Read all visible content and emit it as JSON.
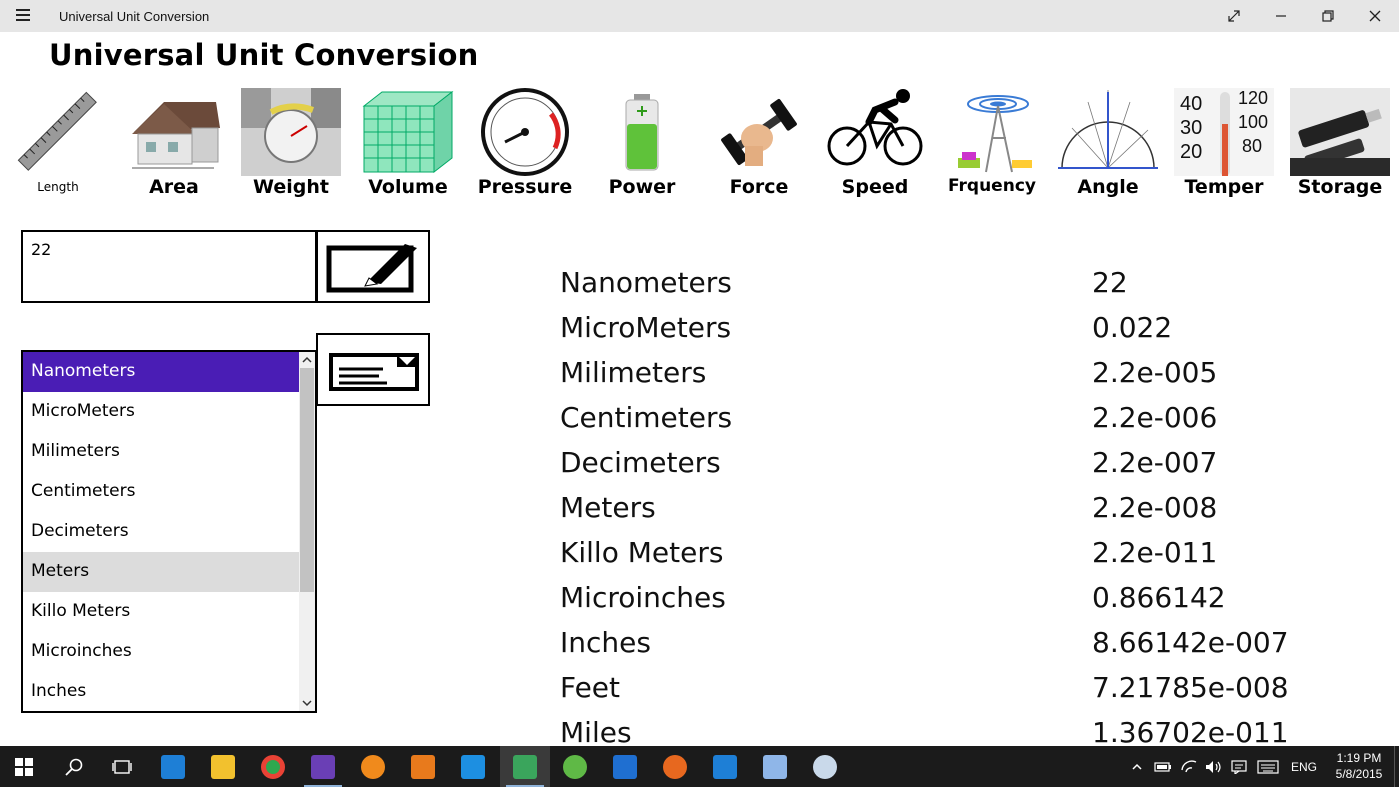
{
  "window": {
    "title": "Universal Unit Conversion"
  },
  "page": {
    "title": "Universal Unit Conversion"
  },
  "categories": [
    {
      "label": "Length",
      "icon": "ruler-icon"
    },
    {
      "label": "Area",
      "icon": "house-icon"
    },
    {
      "label": "Weight",
      "icon": "scale-icon"
    },
    {
      "label": "Volume",
      "icon": "cube-icon"
    },
    {
      "label": "Pressure",
      "icon": "gauge-icon"
    },
    {
      "label": "Power",
      "icon": "battery-icon"
    },
    {
      "label": "Force",
      "icon": "dumbbell-icon"
    },
    {
      "label": "Speed",
      "icon": "cyclist-icon"
    },
    {
      "label": "Frquency",
      "icon": "antenna-icon"
    },
    {
      "label": "Angle",
      "icon": "protractor-icon"
    },
    {
      "label": "Temper",
      "icon": "thermometer-icon"
    },
    {
      "label": "Storage",
      "icon": "usb-drive-icon"
    }
  ],
  "input": {
    "value": "22"
  },
  "unit_list": {
    "items": [
      "Nanometers",
      "MicroMeters",
      "Milimeters",
      "Centimeters",
      "Decimeters",
      "Meters",
      "Killo Meters",
      "Microinches",
      "Inches"
    ],
    "selected": "Nanometers",
    "hovered": "Meters"
  },
  "results": [
    {
      "unit": "Nanometers",
      "value": "22"
    },
    {
      "unit": "MicroMeters",
      "value": "0.022"
    },
    {
      "unit": "Milimeters",
      "value": "2.2e-005"
    },
    {
      "unit": "Centimeters",
      "value": "2.2e-006"
    },
    {
      "unit": "Decimeters",
      "value": "2.2e-007"
    },
    {
      "unit": "Meters",
      "value": "2.2e-008"
    },
    {
      "unit": "Killo Meters",
      "value": "2.2e-011"
    },
    {
      "unit": "Microinches",
      "value": "0.866142"
    },
    {
      "unit": "Inches",
      "value": "8.66142e-007"
    },
    {
      "unit": "Feet",
      "value": "7.21785e-008"
    },
    {
      "unit": "Miles",
      "value": "1.36702e-011"
    }
  ],
  "taskbar": {
    "apps": [
      "ie-icon",
      "file-explorer-icon",
      "chrome-icon",
      "visual-studio-icon",
      "app-icon",
      "media-player-icon",
      "music-icon",
      "unit-converter-icon",
      "utorrent-icon",
      "mail-icon",
      "firefox-icon",
      "store-icon",
      "photo-icon",
      "paint-icon"
    ],
    "language": "ENG",
    "time": "1:19 PM",
    "date": "5/8/2015"
  },
  "colors": {
    "selection": "#4a1db5",
    "titlebar": "#e6e6e6",
    "taskbar": "#1b1b1b"
  }
}
